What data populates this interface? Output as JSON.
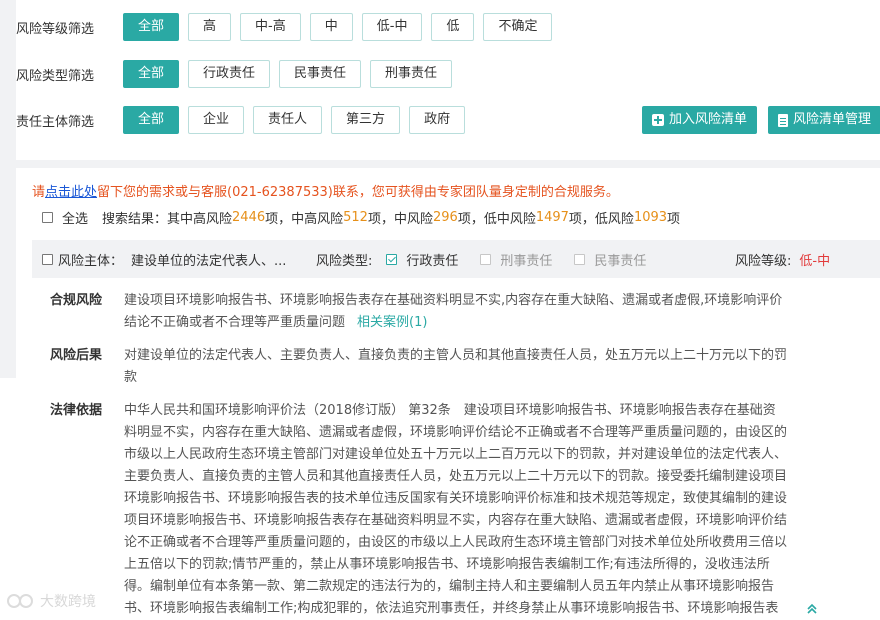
{
  "filters": {
    "level": {
      "label": "风险等级筛选",
      "options": [
        "全部",
        "高",
        "中-高",
        "中",
        "低-中",
        "低",
        "不确定"
      ],
      "active": 0
    },
    "type": {
      "label": "风险类型筛选",
      "options": [
        "全部",
        "行政责任",
        "民事责任",
        "刑事责任"
      ],
      "active": 0
    },
    "subject": {
      "label": "责任主体筛选",
      "options": [
        "全部",
        "企业",
        "责任人",
        "第三方",
        "政府"
      ],
      "active": 0
    }
  },
  "actions": {
    "add_label": "加入风险清单",
    "manage_label": "风险清单管理"
  },
  "notice": {
    "prefix": "请",
    "link": "点击此处",
    "text": "留下您的需求或与客服(021-62387533)联系，您可获得由专家团队量身定制的合规服务。"
  },
  "results": {
    "select_all": "全选",
    "label": "搜索结果：其中高风险",
    "high": "2446",
    "t1": "项，中高风险",
    "mid_high": "512",
    "t2": "项，中风险",
    "mid": "296",
    "t3": "项，低中风险",
    "low_mid": "1497",
    "t4": "项，低风险",
    "low": "1093",
    "t5": "项"
  },
  "risk_item": {
    "subject_label": "风险主体：",
    "subject_value": "建设单位的法定代表人、...",
    "type_label": "风险类型:",
    "types": [
      {
        "label": "行政责任",
        "checked": true
      },
      {
        "label": "刑事责任",
        "checked": false
      },
      {
        "label": "民事责任",
        "checked": false
      }
    ],
    "level_label": "风险等级:",
    "level_value": "低-中",
    "compliance_title": "合规风险",
    "compliance_text": "建设项目环境影响报告书、环境影响报告表存在基础资料明显不实,内容存在重大缺陷、遗漏或者虚假,环境影响评价结论不正确或者不合理等严重质量问题",
    "related_cases": "相关案例(1)",
    "consequence_title": "风险后果",
    "consequence_text": "对建设单位的法定代表人、主要负责人、直接负责的主管人员和其他直接责任人员，处五万元以上二十万元以下的罚款",
    "basis_title": "法律依据",
    "basis_text": "中华人民共和国环境影响评价法（2018修订版） 第32条　建设项目环境影响报告书、环境影响报告表存在基础资料明显不实，内容存在重大缺陷、遗漏或者虚假，环境影响评价结论不正确或者不合理等严重质量问题的，由设区的市级以上人民政府生态环境主管部门对建设单位处五十万元以上二百万元以下的罚款，并对建设单位的法定代表人、主要负责人、直接负责的主管人员和其他直接责任人员，处五万元以上二十万元以下的罚款。接受委托编制建设项目环境影响报告书、环境影响报告表的技术单位违反国家有关环境影响评价标准和技术规范等规定，致使其编制的建设项目环境影响报告书、环境影响报告表存在基础资料明显不实，内容存在重大缺陷、遗漏或者虚假，环境影响评价结论不正确或者不合理等严重质量问题的，由设区的市级以上人民政府生态环境主管部门对技术单位处所收费用三倍以上五倍以下的罚款;情节严重的，禁止从事环境影响报告书、环境影响报告表编制工作;有违法所得的，没收违法所得。编制单位有本条第一款、第二款规定的违法行为的，编制主持人和主要编制人员五年内禁止从事环境影响报告书、环境影响报告表编制工作;构成犯罪的，依法追究刑事责任，并终身禁止从事环境影响报告书、环境影响报告表编制工作。"
  },
  "watermark": "大数跨境",
  "colors": {
    "accent": "#2aa9a4",
    "notice": "#e5531f",
    "count": "#e6901a",
    "risk_level": "#e23b3b"
  }
}
